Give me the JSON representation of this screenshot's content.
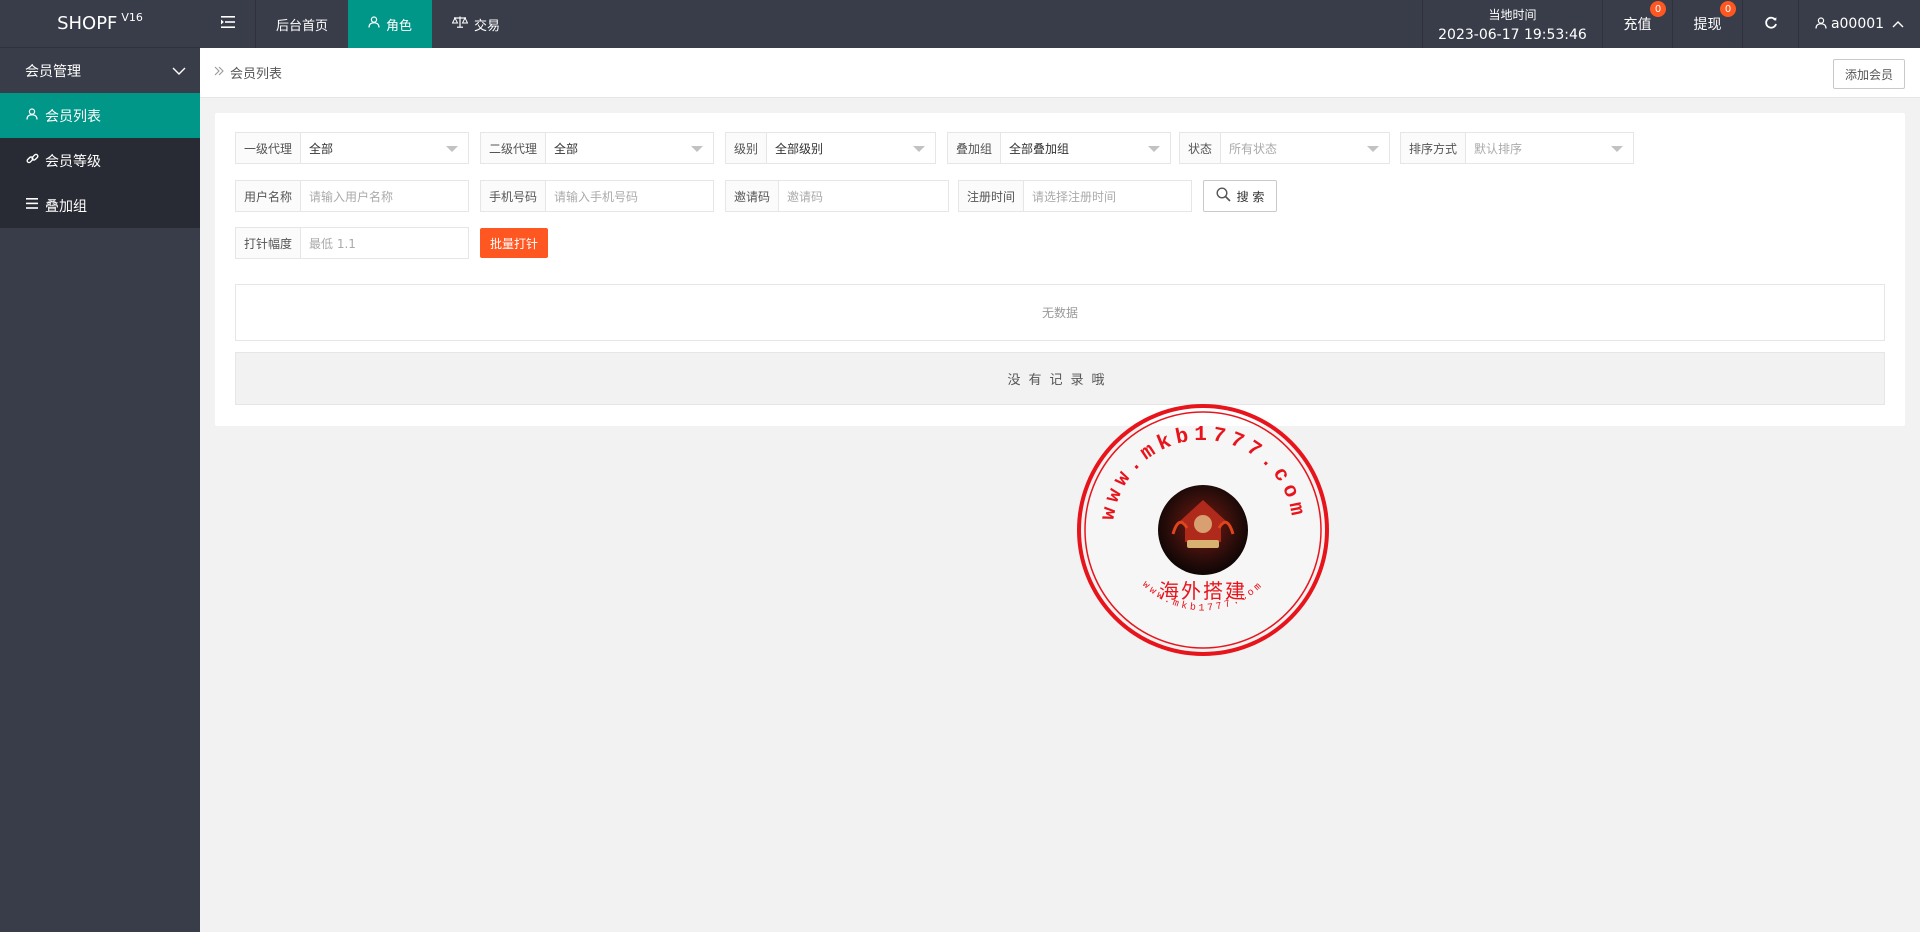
{
  "header": {
    "brand": "SHOPF",
    "version": "V16",
    "nav": [
      {
        "label": "后台首页"
      },
      {
        "label": "角色"
      },
      {
        "label": "交易"
      }
    ],
    "clock_label": "当地时间",
    "clock_value": "2023-06-17 19:53:46",
    "recharge_label": "充值",
    "recharge_count": "0",
    "withdraw_label": "提现",
    "withdraw_count": "0",
    "username": "a00001"
  },
  "sidebar": {
    "group_label": "会员管理",
    "items": [
      {
        "label": "会员列表",
        "icon": "user-icon",
        "active": true
      },
      {
        "label": "会员等级",
        "icon": "link-icon",
        "active": false
      },
      {
        "label": "叠加组",
        "icon": "list-icon",
        "active": false
      }
    ]
  },
  "breadcrumb": {
    "current": "会员列表",
    "add_button": "添加会员"
  },
  "filters": {
    "agent1": {
      "label": "一级代理",
      "value": "全部"
    },
    "agent2": {
      "label": "二级代理",
      "value": "全部"
    },
    "level": {
      "label": "级别",
      "value": "全部级别"
    },
    "group": {
      "label": "叠加组",
      "value": "全部叠加组"
    },
    "status": {
      "label": "状态",
      "placeholder": "所有状态"
    },
    "sort": {
      "label": "排序方式",
      "placeholder": "默认排序"
    },
    "username": {
      "label": "用户名称",
      "placeholder": "请输入用户名称"
    },
    "phone": {
      "label": "手机号码",
      "placeholder": "请输入手机号码"
    },
    "invite": {
      "label": "邀请码",
      "placeholder": "邀请码"
    },
    "regtime": {
      "label": "注册时间",
      "placeholder": "请选择注册时间"
    },
    "search_button": "搜 索",
    "needle": {
      "label": "打针幅度",
      "placeholder": "最低 1.1"
    },
    "batch_button": "批量打针"
  },
  "table": {
    "empty_text": "无数据",
    "no_record_text": "没有记录哦"
  },
  "watermark": {
    "url_text": "www.mkb1777.com",
    "caption": "海外搭建"
  },
  "colors": {
    "header_bg": "#393d49",
    "accent": "#009688",
    "danger": "#ff5722",
    "stamp_red": "#e8141c"
  }
}
